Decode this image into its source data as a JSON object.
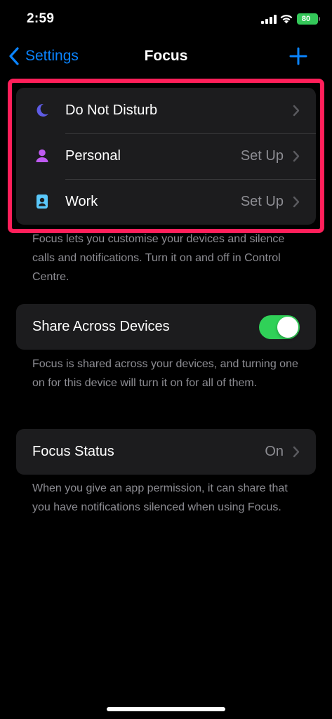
{
  "status_bar": {
    "time": "2:59",
    "battery_level": "80",
    "battery_color": "#34c759"
  },
  "nav": {
    "back_label": "Settings",
    "title": "Focus",
    "add_icon": "plus-icon",
    "accent_color": "#0a84ff"
  },
  "focus_modes": [
    {
      "label": "Do Not Disturb",
      "value": "",
      "icon": "moon-icon",
      "icon_color": "#5e5ce6"
    },
    {
      "label": "Personal",
      "value": "Set Up",
      "icon": "person-icon",
      "icon_color": "#bf5af2"
    },
    {
      "label": "Work",
      "value": "Set Up",
      "icon": "id-badge-icon",
      "icon_color": "#5ac8fa"
    }
  ],
  "focus_modes_footer": "Focus lets you customise your devices and silence calls and notifications. Turn it on and off in Control Centre.",
  "share": {
    "label": "Share Across Devices",
    "enabled": true,
    "footer": "Focus is shared across your devices, and turning one on for this device will turn it on for all of them."
  },
  "focus_status": {
    "label": "Focus Status",
    "value": "On",
    "footer": "When you give an app permission, it can share that you have notifications silenced when using Focus."
  },
  "highlight_color": "#ff1f5a"
}
